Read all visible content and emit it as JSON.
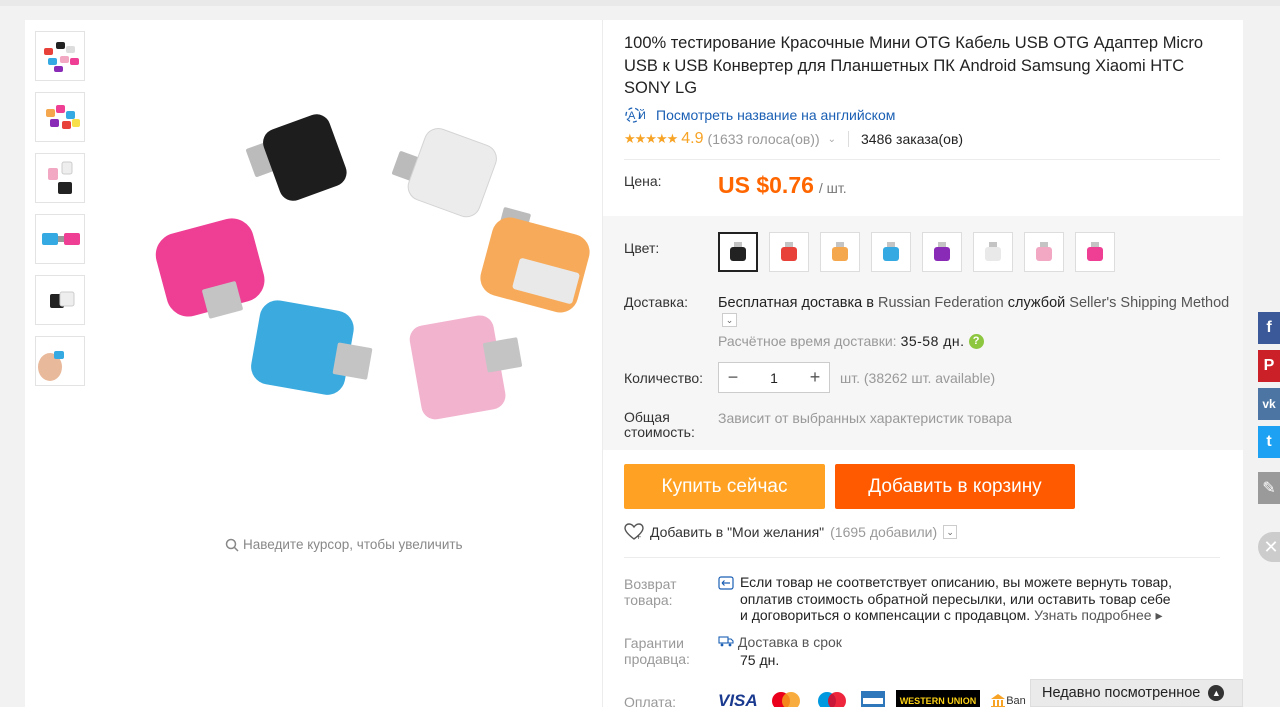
{
  "product": {
    "title": "100% тестирование Красочные Мини OTG Кабель USB OTG Адаптер Micro USB к USB Конвертер для Планшетных ПК Android Samsung Xiaomi HTC SONY LG",
    "translate_link": "Посмотреть название на английском",
    "stars": "★★★★★",
    "rating": "4.9",
    "votes": "(1633 голоса(ов))",
    "orders": "3486 заказа(ов)"
  },
  "gallery": {
    "zoom_hint": "Наведите курсор, чтобы увеличить",
    "thumbnails": [
      "multi-colors",
      "colors-pile",
      "pink-black",
      "blue-pink",
      "black-white",
      "in-hand"
    ]
  },
  "price": {
    "label": "Цена:",
    "value": "US $0.76",
    "unit": "/ шт."
  },
  "color": {
    "label": "Цвет:",
    "options": [
      {
        "name": "black",
        "hex": "#222222",
        "selected": true
      },
      {
        "name": "red",
        "hex": "#e8413a"
      },
      {
        "name": "orange",
        "hex": "#f5a74e"
      },
      {
        "name": "blue",
        "hex": "#35a9e1"
      },
      {
        "name": "purple",
        "hex": "#8a2bb8"
      },
      {
        "name": "white",
        "hex": "#e9e9e9"
      },
      {
        "name": "pink",
        "hex": "#f2a7c3"
      },
      {
        "name": "rose",
        "hex": "#ee3f95"
      }
    ]
  },
  "shipping": {
    "label": "Доставка:",
    "free": "Бесплатная доставка в",
    "destination": "Russian Federation",
    "via": "службой",
    "method": "Seller's Shipping Method",
    "eta_label": "Расчётное время доставки:",
    "eta_value": "35-58 дн.",
    "help_icon": "?"
  },
  "quantity": {
    "label": "Количество:",
    "minus": "−",
    "value": "1",
    "plus": "+",
    "available": "шт. (38262 шт. available)"
  },
  "total": {
    "label_line1": "Общая",
    "label_line2": "стоимость:",
    "value": "Зависит от выбранных характеристик товара"
  },
  "actions": {
    "buy_now": "Купить сейчас",
    "add_to_cart": "Добавить в корзину",
    "wishlist": "Добавить в \"Мои желания\"",
    "wishlist_count": "(1695 добавили)"
  },
  "returns": {
    "label_line1": "Возврат",
    "label_line2": "товара:",
    "text": "Если товар не соответствует описанию, вы можете вернуть товар, оплатив стоимость обратной пересылки, или оставить товар себе и договориться о компенсации с продавцом.",
    "more": "Узнать подробнее ▸"
  },
  "guarantee": {
    "label_line1": "Гарантии",
    "label_line2": "продавца:",
    "title": "Доставка в срок",
    "days": "75 дн."
  },
  "payment": {
    "label": "Оплата:",
    "methods": [
      "VISA",
      "MasterCard",
      "Maestro",
      "AMEX",
      "WESTERN UNION",
      "Ban"
    ]
  },
  "recent": {
    "label": "Недавно посмотренное",
    "icon": "▲"
  },
  "social": {
    "facebook": "f",
    "pinterest": "P",
    "vk": "vk",
    "twitter": "t",
    "edit": "✎",
    "close": "✕"
  },
  "colors": {
    "price": "#ff6600",
    "buy": "#ffa224",
    "cart": "#ff5a00",
    "link": "#1a5fb4",
    "star": "#f7a325"
  }
}
